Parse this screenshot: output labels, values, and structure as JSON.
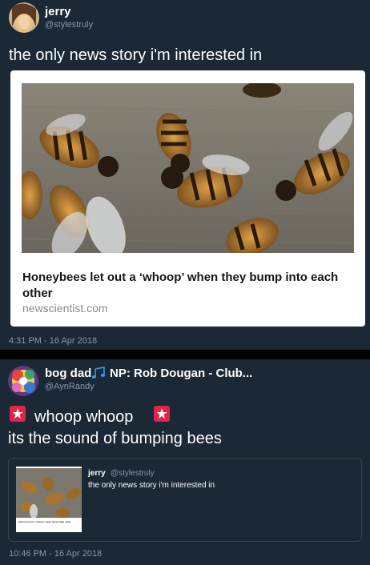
{
  "tweet1": {
    "display_name": "jerry",
    "handle": "@stylestruly",
    "text": "the only news story i'm interested in",
    "link_card": {
      "title": "Honeybees let out a ‘whoop’ when they bump into each other",
      "domain": "newscientist.com"
    },
    "timestamp": "4:31 PM - 16 Apr 2018"
  },
  "tweet2": {
    "display_name_prefix": "bog dad",
    "display_name_suffix": "NP: Rob Dougan - Club...",
    "handle": "@AynRandy",
    "text_line1": "whoop whoop",
    "text_line2": "its the sound of bumping bees",
    "quote": {
      "display_name": "jerry",
      "handle": "@stylestruly",
      "text": "the only news story i'm interested in",
      "thumb_text": "ybees let out a 'whoop' when they bump other"
    },
    "timestamp": "10:46 PM - 16 Apr 2018"
  },
  "icons": {
    "music": "music-notes-icon",
    "siren": "rotating-light-icon"
  },
  "colors": {
    "background": "#1b2836",
    "divider": "#000000",
    "secondary_text": "#8899a6",
    "music_accent": "#2f9df2",
    "siren_red": "#e0244a"
  }
}
